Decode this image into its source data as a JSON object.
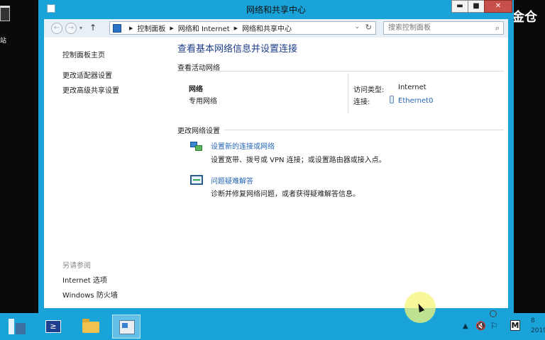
{
  "desktop": {
    "icon_label": "站"
  },
  "watermark": {
    "text": "金仓"
  },
  "window": {
    "title": "网络和共享中心",
    "buttons": {
      "minimize": "▬",
      "maximize": "■",
      "close": "✕"
    }
  },
  "toolbar": {
    "back": "←",
    "forward": "→",
    "up": "↑",
    "breadcrumb": [
      "控制面板",
      "网络和 Internet",
      "网络和共享中心"
    ],
    "refresh": "↻",
    "search_placeholder": "搜索控制面板"
  },
  "sidebar": {
    "items": [
      {
        "label": "控制面板主页"
      },
      {
        "label": "更改适配器设置"
      },
      {
        "label": "更改高级共享设置"
      }
    ],
    "see_also_title": "另请参阅",
    "see_also": [
      {
        "label": "Internet 选项"
      },
      {
        "label": "Windows 防火墙"
      }
    ]
  },
  "main": {
    "heading": "查看基本网络信息并设置连接",
    "active_networks_title": "查看活动网络",
    "network": {
      "name": "网络",
      "type": "专用网络",
      "access_label": "访问类型:",
      "access_value": "Internet",
      "connection_label": "连接:",
      "connection_value": "Ethernet0"
    },
    "change_settings_title": "更改网络设置",
    "tasks": [
      {
        "title": "设置新的连接或网络",
        "desc": "设置宽带、拨号或 VPN 连接；或设置路由器或接入点。"
      },
      {
        "title": "问题疑难解答",
        "desc": "诊断并修复网络问题，或者获得疑难解答信息。"
      }
    ]
  },
  "taskbar": {
    "powershell_glyph": "≥",
    "tray_up": "▲",
    "ime": "M",
    "clock_line1": "8",
    "clock_line2": "2019"
  },
  "colors": {
    "accent": "#1aa3d9",
    "link": "#2666b5",
    "heading": "#1e3e8a"
  }
}
